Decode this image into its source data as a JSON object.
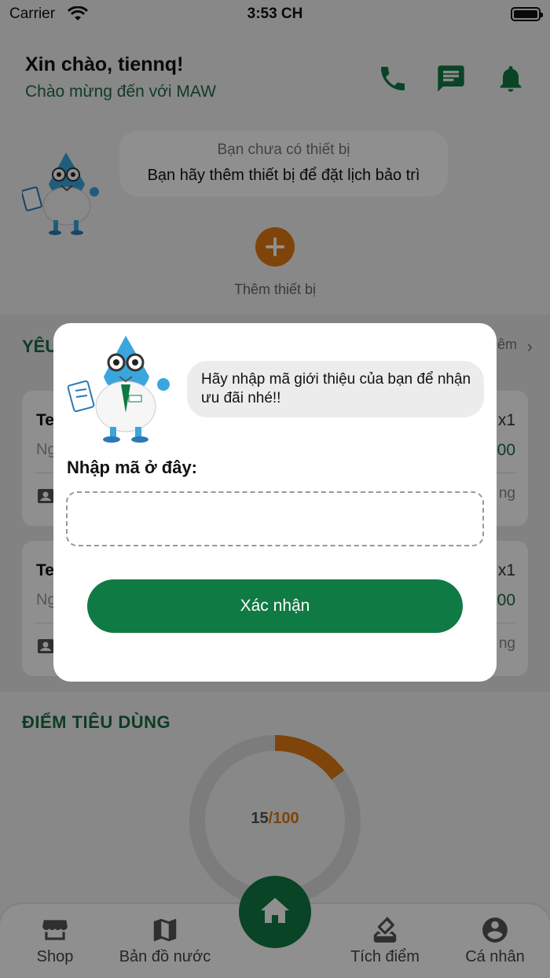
{
  "status_bar": {
    "carrier": "Carrier",
    "time": "3:53 CH"
  },
  "header": {
    "greeting": "Xin chào, tiennq!",
    "subtitle": "Chào mừng đến với MAW",
    "accent_color": "#0f7a43"
  },
  "device_empty": {
    "line1": "Bạn chưa có thiết bị",
    "line2": "Bạn hãy thêm thiết bị để đặt lịch bảo trì",
    "add_label": "Thêm thiết bị",
    "add_color": "#e07a10"
  },
  "requests": {
    "title": "YÊU",
    "more": "êm",
    "cards": [
      {
        "title": "Te",
        "date": "Ng",
        "qty": "x1",
        "price": "00",
        "status": "ng"
      },
      {
        "title": "Te",
        "date": "Ng",
        "qty": "x1",
        "price": "00",
        "status": "ng"
      }
    ]
  },
  "points": {
    "title": "ĐIỂM TIÊU DÙNG",
    "current": "15",
    "max": "/100",
    "progress_fraction": 0.15
  },
  "nav": {
    "shop": "Shop",
    "map": "Bản đồ nước",
    "points": "Tích điểm",
    "profile": "Cá nhân"
  },
  "modal": {
    "bubble_text": "Hãy nhập mã giới thiệu của bạn để nhận ưu đãi nhé!!",
    "label": "Nhập mã ở đây:",
    "input_value": "",
    "confirm": "Xác nhận"
  }
}
